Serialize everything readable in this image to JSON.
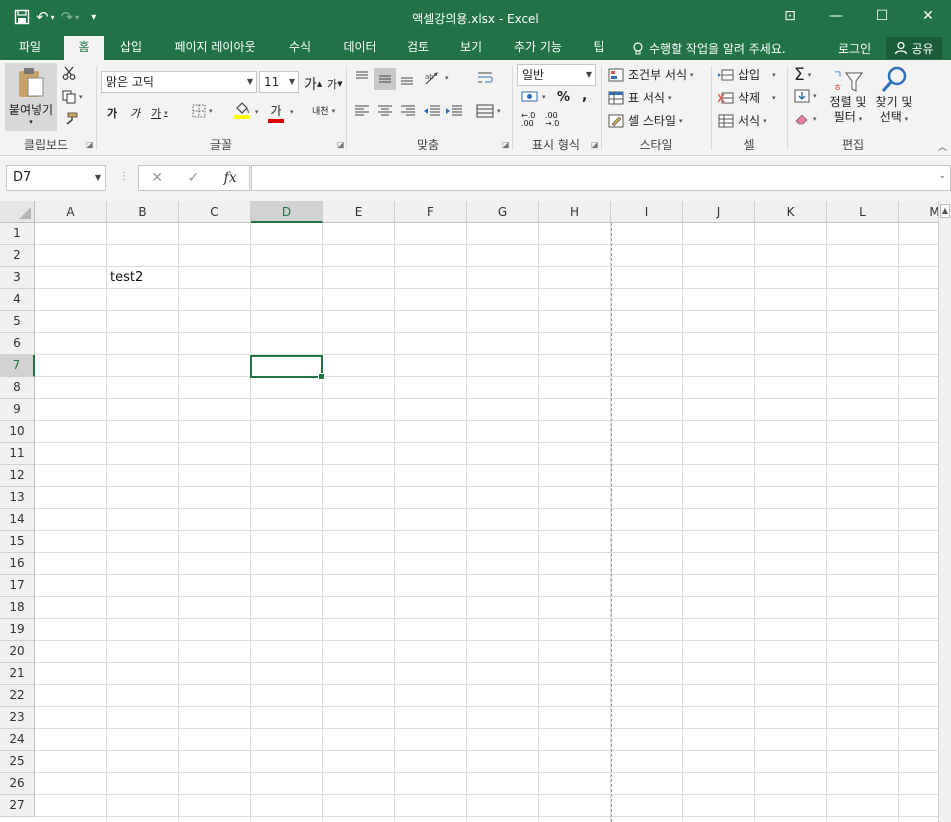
{
  "window": {
    "title": "액셀강의용.xlsx - Excel",
    "controls": [
      "⊡",
      "—",
      "☐",
      "✕"
    ]
  },
  "qat": {
    "save": "💾",
    "undo": "↶",
    "redo": "↷",
    "customize": "▾"
  },
  "tabs": [
    "파일",
    "홈",
    "삽입",
    "페이지 레이아웃",
    "수식",
    "데이터",
    "검토",
    "보기",
    "추가 기능",
    "팁"
  ],
  "active_tab": "홈",
  "tell_me": "수행할 작업을 알려 주세요.",
  "account": {
    "login": "로그인",
    "share": "공유"
  },
  "ribbon": {
    "clipboard": {
      "label": "클립보드",
      "paste": "붙여넣기"
    },
    "font": {
      "label": "글꼴",
      "font_name": "맑은 고딕",
      "font_size": "11",
      "grow": "가",
      "shrink": "가",
      "bold": "가",
      "italic": "가",
      "underline": "가",
      "font_color_glyph": "가",
      "phonetic": "내천"
    },
    "alignment": {
      "label": "맞춤"
    },
    "number": {
      "label": "표시 형식",
      "format": "일반",
      "percent": "%",
      "comma": ","
    },
    "styles": {
      "label": "스타일",
      "conditional": "조건부 서식",
      "table": "표 서식",
      "cell_styles": "셀 스타일"
    },
    "cells": {
      "label": "셀",
      "insert": "삽입",
      "delete": "삭제",
      "format": "서식"
    },
    "editing": {
      "label": "편집",
      "sort_filter_1": "정렬 및",
      "sort_filter_2": "필터",
      "find_1": "찾기 및",
      "find_2": "선택"
    }
  },
  "formula_bar": {
    "name_box": "D7",
    "value": "",
    "cancel": "✕",
    "enter": "✓",
    "fx": "fx"
  },
  "sheet": {
    "columns": [
      "A",
      "B",
      "C",
      "D",
      "E",
      "F",
      "G",
      "H",
      "I",
      "J",
      "K",
      "L",
      "M"
    ],
    "rows": [
      "1",
      "2",
      "3",
      "4",
      "5",
      "6",
      "7",
      "8",
      "9",
      "10",
      "11",
      "12",
      "13",
      "14",
      "15",
      "16",
      "17",
      "18",
      "19",
      "20",
      "21",
      "22",
      "23",
      "24",
      "25",
      "26",
      "27"
    ],
    "selected_cell": "D7",
    "selected_column": "D",
    "selected_row": "7",
    "cells": [
      {
        "ref": "B3",
        "value": "test2"
      }
    ]
  },
  "colors": {
    "accent": "#217346",
    "ribbon_bg": "#f3f3f3"
  }
}
